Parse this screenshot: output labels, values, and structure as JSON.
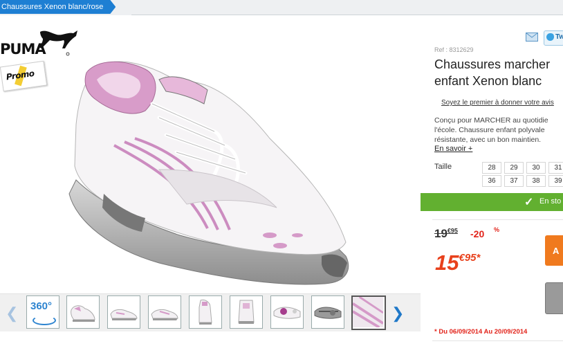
{
  "breadcrumb": {
    "current": "Chaussures Xenon blanc/rose"
  },
  "brand": {
    "logo_text": "PUMA",
    "promo_sticker": "Promo"
  },
  "gallery": {
    "badge_360": "360°",
    "thumb_count": 9
  },
  "product": {
    "ref": "Ref : 8312629",
    "title_line1": "Chaussures marcher",
    "title_line2": "enfant Xenon blanc",
    "review_link": "Soyez le premier à donner votre avis",
    "desc_line1": "Conçu pour MARCHER au quotidie",
    "desc_line2": "l'école. Chaussure enfant polyvale",
    "desc_line3": "résistante, avec un bon maintien.",
    "more_link": "En savoir +",
    "size_label": "Taille",
    "sizes": [
      "28",
      "29",
      "30",
      "31",
      "36",
      "37",
      "38",
      "39"
    ],
    "stock_text": "En sto",
    "old_price_int": "19",
    "old_price_dec": "€95",
    "discount": "-20",
    "discount_sign": "%",
    "price_int": "15",
    "price_dec": "€95*",
    "add_label": "A",
    "promo_dates": "* Du 06/09/2014 Au 20/09/2014"
  },
  "share": {
    "twitter_label": "Tw"
  },
  "colors": {
    "accent_blue": "#1e7fd3",
    "price_orange": "#e8411c",
    "stock_green": "#62b030",
    "promo_red": "#e2231a"
  }
}
